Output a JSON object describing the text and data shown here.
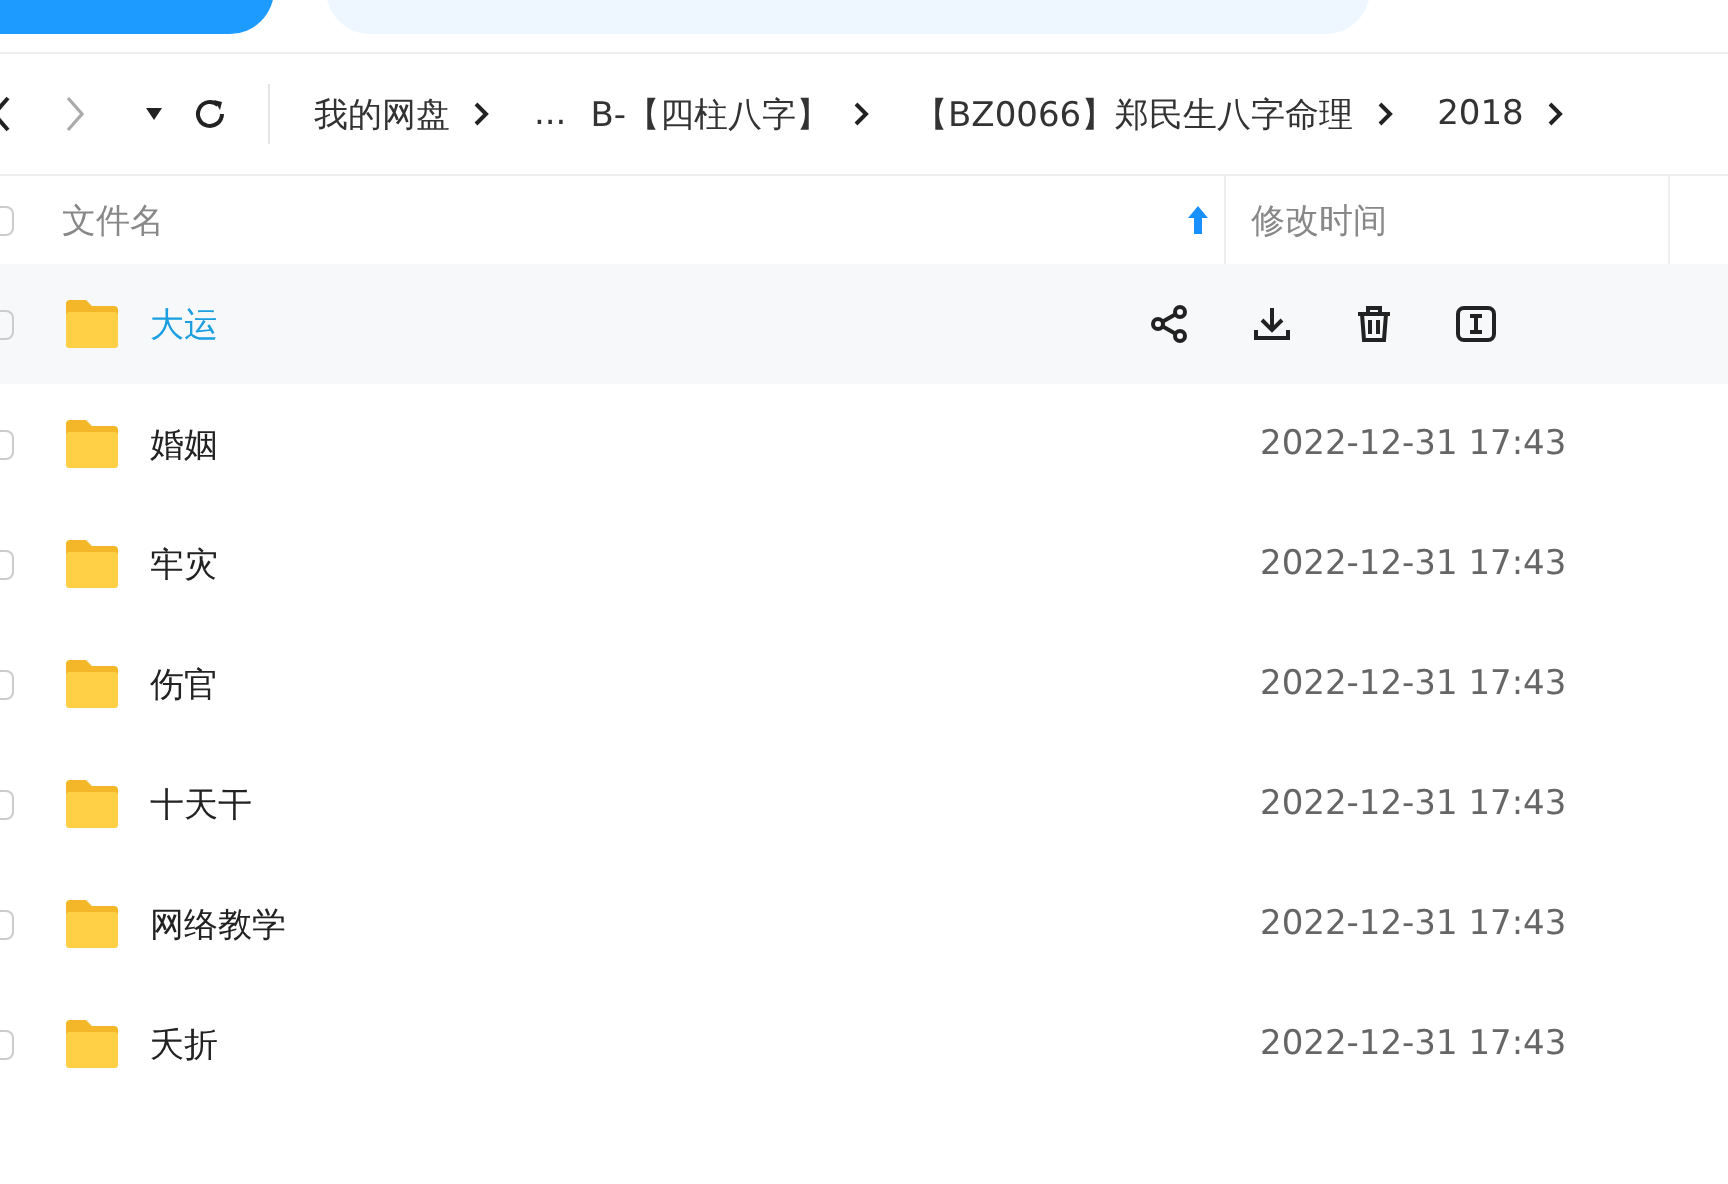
{
  "breadcrumb": [
    {
      "label": "我的网盘"
    },
    {
      "label": "..."
    },
    {
      "label": "B-【四柱八字】"
    },
    {
      "label": "【BZ0066】郑民生八字命理"
    },
    {
      "label": "2018"
    }
  ],
  "table": {
    "all_checked": false,
    "columns": [
      {
        "label": "文件名",
        "sorted": true
      },
      {
        "label": "修改时间",
        "sorted": false
      }
    ],
    "rows": [
      {
        "name": "大运",
        "hovered": true,
        "checked": false
      },
      {
        "name": "婚姻",
        "time": "2022-12-31 17:43",
        "hovered": false,
        "checked": false
      },
      {
        "name": "牢灾",
        "time": "2022-12-31 17:43",
        "hovered": false,
        "checked": false
      },
      {
        "name": "伤官",
        "time": "2022-12-31 17:43",
        "hovered": false,
        "checked": false
      },
      {
        "name": "十天干",
        "time": "2022-12-31 17:43",
        "hovered": false,
        "checked": false
      },
      {
        "name": "网络教学",
        "time": "2022-12-31 17:43",
        "hovered": false,
        "checked": false
      },
      {
        "name": "夭折",
        "time": "2022-12-31 17:43",
        "hovered": false,
        "checked": false
      }
    ]
  }
}
